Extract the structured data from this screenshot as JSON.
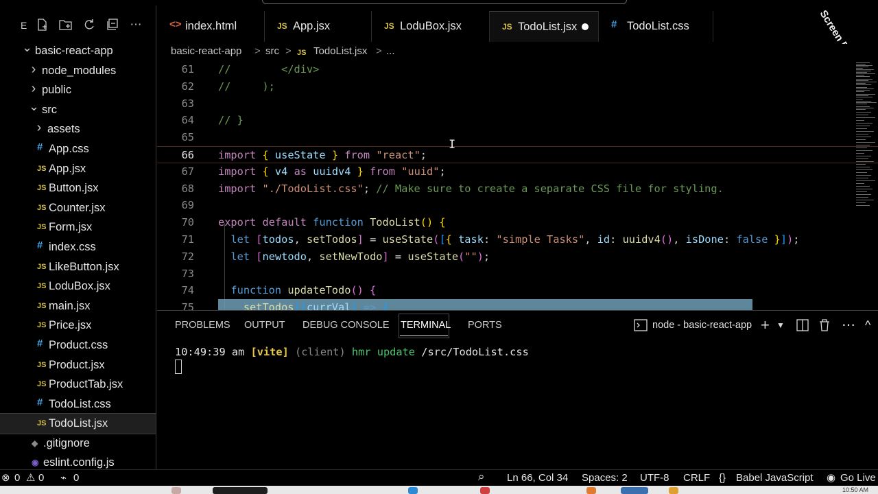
{
  "sidebar": {
    "explorer_letter": "E",
    "toolbar_icons": [
      "new-file-icon",
      "new-folder-icon",
      "refresh-icon",
      "collapse-icon",
      "more-icon"
    ],
    "tree": [
      {
        "label": "basic-react-app",
        "type": "folder-open",
        "depth": 0
      },
      {
        "label": "node_modules",
        "type": "folder",
        "depth": 1
      },
      {
        "label": "public",
        "type": "folder",
        "depth": 1
      },
      {
        "label": "src",
        "type": "folder-open",
        "depth": 1
      },
      {
        "label": "assets",
        "type": "folder",
        "depth": 2
      },
      {
        "label": "App.css",
        "type": "css",
        "depth": 2
      },
      {
        "label": "App.jsx",
        "type": "js",
        "depth": 2
      },
      {
        "label": "Button.jsx",
        "type": "js",
        "depth": 2
      },
      {
        "label": "Counter.jsx",
        "type": "js",
        "depth": 2
      },
      {
        "label": "Form.jsx",
        "type": "js",
        "depth": 2
      },
      {
        "label": "index.css",
        "type": "css",
        "depth": 2
      },
      {
        "label": "LikeButton.jsx",
        "type": "js",
        "depth": 2
      },
      {
        "label": "LoduBox.jsx",
        "type": "js",
        "depth": 2
      },
      {
        "label": "main.jsx",
        "type": "js",
        "depth": 2
      },
      {
        "label": "Price.jsx",
        "type": "js",
        "depth": 2
      },
      {
        "label": "Product.css",
        "type": "css",
        "depth": 2
      },
      {
        "label": "Product.jsx",
        "type": "js",
        "depth": 2
      },
      {
        "label": "ProductTab.jsx",
        "type": "js",
        "depth": 2
      },
      {
        "label": "TodoList.css",
        "type": "css",
        "depth": 2
      },
      {
        "label": "TodoList.jsx",
        "type": "js",
        "depth": 2,
        "selected": true
      },
      {
        "label": ".gitignore",
        "type": "git",
        "depth": 1
      },
      {
        "label": "eslint.config.js",
        "type": "cfg",
        "depth": 1
      }
    ],
    "icon_glyphs": {
      "js": "JS",
      "css": "#",
      "git": "◆",
      "cfg": "◉"
    }
  },
  "tabs": [
    {
      "label": "index.html",
      "icon": "<>",
      "icon_type": "html"
    },
    {
      "label": "App.jsx",
      "icon": "JS",
      "icon_type": "js"
    },
    {
      "label": "LoduBox.jsx",
      "icon": "JS",
      "icon_type": "js"
    },
    {
      "label": "TodoList.jsx",
      "icon": "JS",
      "icon_type": "js",
      "active": true,
      "modified": true
    },
    {
      "label": "TodoList.css",
      "icon": "#",
      "icon_type": "css"
    }
  ],
  "breadcrumb": {
    "root": "basic-react-app",
    "folder": "src",
    "file_icon": "JS",
    "file": "TodoList.jsx",
    "tail": "...",
    "separator": ">"
  },
  "editor": {
    "current_line": 66,
    "lines": [
      {
        "n": "61",
        "tokens": [
          [
            "c-com",
            "//        </div>"
          ]
        ]
      },
      {
        "n": "62",
        "tokens": [
          [
            "c-com",
            "//     );"
          ]
        ]
      },
      {
        "n": "63",
        "tokens": []
      },
      {
        "n": "64",
        "tokens": [
          [
            "c-com",
            "// }"
          ]
        ]
      },
      {
        "n": "65",
        "tokens": []
      },
      {
        "n": "66",
        "tokens": [
          [
            "c-ctl",
            "import"
          ],
          [
            "c-punc",
            " "
          ],
          [
            "c-br1",
            "{"
          ],
          [
            "c-punc",
            " "
          ],
          [
            "c-var",
            "useState"
          ],
          [
            "c-punc",
            " "
          ],
          [
            "c-br1",
            "}"
          ],
          [
            "c-punc",
            " "
          ],
          [
            "c-ctl",
            "from"
          ],
          [
            "c-punc",
            " "
          ],
          [
            "c-str",
            "\"react\""
          ],
          [
            "c-punc",
            ";"
          ]
        ]
      },
      {
        "n": "67",
        "tokens": [
          [
            "c-ctl",
            "import"
          ],
          [
            "c-punc",
            " "
          ],
          [
            "c-br1",
            "{"
          ],
          [
            "c-punc",
            " "
          ],
          [
            "c-var",
            "v4"
          ],
          [
            "c-punc",
            " "
          ],
          [
            "c-ctl",
            "as"
          ],
          [
            "c-punc",
            " "
          ],
          [
            "c-var",
            "uuidv4"
          ],
          [
            "c-punc",
            " "
          ],
          [
            "c-br1",
            "}"
          ],
          [
            "c-punc",
            " "
          ],
          [
            "c-ctl",
            "from"
          ],
          [
            "c-punc",
            " "
          ],
          [
            "c-str",
            "\"uuid\""
          ],
          [
            "c-punc",
            ";"
          ]
        ]
      },
      {
        "n": "68",
        "tokens": [
          [
            "c-ctl",
            "import"
          ],
          [
            "c-punc",
            " "
          ],
          [
            "c-str",
            "\"./TodoList.css\""
          ],
          [
            "c-punc",
            "; "
          ],
          [
            "c-com",
            "// Make sure to create a separate CSS file for styling."
          ]
        ]
      },
      {
        "n": "69",
        "tokens": []
      },
      {
        "n": "70",
        "tokens": [
          [
            "c-ctl",
            "export"
          ],
          [
            "c-punc",
            " "
          ],
          [
            "c-ctl",
            "default"
          ],
          [
            "c-punc",
            " "
          ],
          [
            "c-kw",
            "function"
          ],
          [
            "c-punc",
            " "
          ],
          [
            "c-fn",
            "TodoList"
          ],
          [
            "c-br1",
            "()"
          ],
          [
            "c-punc",
            " "
          ],
          [
            "c-br1",
            "{"
          ]
        ]
      },
      {
        "n": "71",
        "tokens": [
          [
            "c-punc",
            "  "
          ],
          [
            "c-kw",
            "let"
          ],
          [
            "c-punc",
            " "
          ],
          [
            "c-br2",
            "["
          ],
          [
            "c-var",
            "todos"
          ],
          [
            "c-punc",
            ", "
          ],
          [
            "c-fn",
            "setTodos"
          ],
          [
            "c-br2",
            "]"
          ],
          [
            "c-punc",
            " = "
          ],
          [
            "c-fn",
            "useState"
          ],
          [
            "c-br2",
            "("
          ],
          [
            "c-br3",
            "["
          ],
          [
            "c-br1",
            "{"
          ],
          [
            "c-punc",
            " "
          ],
          [
            "c-var",
            "task"
          ],
          [
            "c-punc",
            ": "
          ],
          [
            "c-str",
            "\"simple Tasks\""
          ],
          [
            "c-punc",
            ", "
          ],
          [
            "c-var",
            "id"
          ],
          [
            "c-punc",
            ": "
          ],
          [
            "c-fn",
            "uuidv4"
          ],
          [
            "c-br2",
            "()"
          ],
          [
            "c-punc",
            ", "
          ],
          [
            "c-var",
            "isDone"
          ],
          [
            "c-punc",
            ": "
          ],
          [
            "c-kw",
            "false"
          ],
          [
            "c-punc",
            " "
          ],
          [
            "c-br1",
            "}"
          ],
          [
            "c-br3",
            "]"
          ],
          [
            "c-br2",
            ")"
          ],
          [
            "c-punc",
            ";"
          ]
        ]
      },
      {
        "n": "72",
        "tokens": [
          [
            "c-punc",
            "  "
          ],
          [
            "c-kw",
            "let"
          ],
          [
            "c-punc",
            " "
          ],
          [
            "c-br2",
            "["
          ],
          [
            "c-var",
            "newtodo"
          ],
          [
            "c-punc",
            ", "
          ],
          [
            "c-fn",
            "setNewTodo"
          ],
          [
            "c-br2",
            "]"
          ],
          [
            "c-punc",
            " = "
          ],
          [
            "c-fn",
            "useState"
          ],
          [
            "c-br2",
            "("
          ],
          [
            "c-str",
            "\"\""
          ],
          [
            "c-br2",
            ")"
          ],
          [
            "c-punc",
            ";"
          ]
        ]
      },
      {
        "n": "73",
        "tokens": []
      },
      {
        "n": "74",
        "tokens": [
          [
            "c-punc",
            "  "
          ],
          [
            "c-kw",
            "function"
          ],
          [
            "c-punc",
            " "
          ],
          [
            "c-fn",
            "updateTodo"
          ],
          [
            "c-br2",
            "()"
          ],
          [
            "c-punc",
            " "
          ],
          [
            "c-br2",
            "{"
          ]
        ]
      },
      {
        "n": "75",
        "tokens": [
          [
            "c-punc",
            "    "
          ],
          [
            "c-fn",
            "setTodos"
          ],
          [
            "c-br3",
            "(("
          ],
          [
            "c-var",
            "currVal"
          ],
          [
            "c-br3",
            ")"
          ],
          [
            "c-punc",
            " "
          ],
          [
            "c-kw",
            "=>"
          ],
          [
            "c-punc",
            " "
          ],
          [
            "c-br3",
            "{"
          ]
        ]
      }
    ]
  },
  "panel": {
    "tabs": [
      "PROBLEMS",
      "OUTPUT",
      "DEBUG CONSOLE",
      "TERMINAL",
      "PORTS"
    ],
    "active_tab": "TERMINAL",
    "terminal_name": "node - basic-react-app",
    "actions": [
      "terminal-icon",
      "add-icon",
      "chevron-down-icon",
      "split-icon",
      "trash-icon",
      "more-icon",
      "chevron-up-icon"
    ],
    "terminal": {
      "time": "10:49:39 am",
      "tag": "[vite]",
      "client": "(client)",
      "event": "hmr update",
      "path": "/src/TodoList.css"
    }
  },
  "statusbar": {
    "errors": "0",
    "warnings": "0",
    "ports": "0",
    "position": "Ln 66, Col 34",
    "spaces": "Spaces: 2",
    "encoding": "UTF-8",
    "eol": "CRLF",
    "language": "Babel JavaScript",
    "golive": "Go Live",
    "glyphs": {
      "error": "⊗",
      "warning": "⚠",
      "ports": "⌁",
      "zoom": "⌕",
      "braces": "{}",
      "golive": "◉"
    }
  },
  "taskbar": {
    "clock": "10:50 AM"
  },
  "watermark": "Screen Rec"
}
